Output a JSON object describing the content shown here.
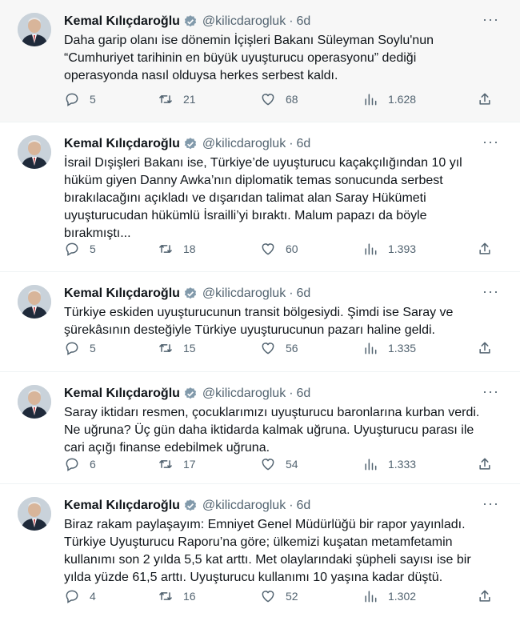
{
  "tweets": [
    {
      "name": "Kemal Kılıçdaroğlu",
      "handle": "@kilicdarogluk",
      "time": "6d",
      "text": "Daha garip olanı ise dönemin İçişleri Bakanı Süleyman Soylu'nun\n“Cumhuriyet tarihinin en büyük uyuşturucu operasyonu” dediği\noperasyonda nasıl olduysa herkes serbest kaldı.",
      "replies": "5",
      "retweets": "21",
      "likes": "68",
      "views": "1.628"
    },
    {
      "name": "Kemal Kılıçdaroğlu",
      "handle": "@kilicdarogluk",
      "time": "6d",
      "text": "İsrail Dışişleri Bakanı ise, Türkiye’de uyuşturucu kaçakçılığından 10 yıl\nhüküm giyen Danny Awka’nın diplomatik temas sonucunda serbest\nbırakılacağını açıkladı ve dışarıdan talimat alan Saray Hükümeti\nuyuşturucudan hükümlü İsrailli’yi bıraktı. Malum papazı da böyle\nbırakmıştı...",
      "replies": "5",
      "retweets": "18",
      "likes": "60",
      "views": "1.393"
    },
    {
      "name": "Kemal Kılıçdaroğlu",
      "handle": "@kilicdarogluk",
      "time": "6d",
      "text": "Türkiye eskiden uyuşturucunun transit bölgesiydi. Şimdi ise Saray ve\nşürekâsının desteğiyle Türkiye uyuşturucunun pazarı haline geldi.",
      "replies": "5",
      "retweets": "15",
      "likes": "56",
      "views": "1.335"
    },
    {
      "name": "Kemal Kılıçdaroğlu",
      "handle": "@kilicdarogluk",
      "time": "6d",
      "text": "Saray iktidarı resmen, çocuklarımızı uyuşturucu baronlarına kurban verdi.\nNe uğruna? Üç gün daha iktidarda kalmak uğruna. Uyuşturucu parası ile\ncari açığı finanse edebilmek uğruna.",
      "replies": "6",
      "retweets": "17",
      "likes": "54",
      "views": "1.333"
    },
    {
      "name": "Kemal Kılıçdaroğlu",
      "handle": "@kilicdarogluk",
      "time": "6d",
      "text": "Biraz rakam paylaşayım: Emniyet Genel Müdürlüğü bir rapor yayınladı.\nTürkiye Uyuşturucu Raporu’na göre; ülkemizi kuşatan metamfetamin\nkullanımı son 2 yılda 5,5 kat arttı. Met olaylarındaki şüpheli sayısı ise bir\nyılda yüzde 61,5 arttı. Uyuşturucu kullanımı 10 yaşına kadar düştü.",
      "replies": "4",
      "retweets": "16",
      "likes": "52",
      "views": "1.302"
    }
  ],
  "more_glyph": "···",
  "dot": "·",
  "colors": {
    "text": "#0f1419",
    "muted": "#536471",
    "verified": "#829aab",
    "highlight_bg": "#f7f7f7"
  }
}
